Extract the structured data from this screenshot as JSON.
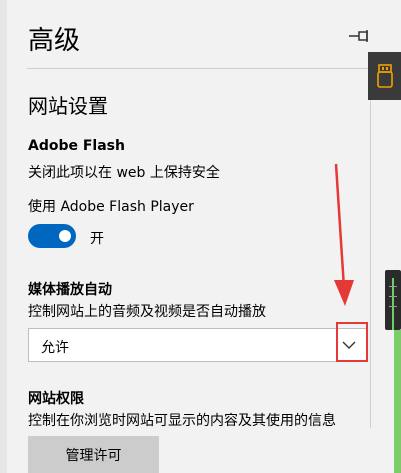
{
  "panel": {
    "title": "高级"
  },
  "website_settings": {
    "heading": "网站设置",
    "flash": {
      "title": "Adobe Flash",
      "description": "关闭此项以在 web 上保持安全",
      "toggle_label": "使用 Adobe Flash Player",
      "toggle_state": "开"
    },
    "media_autoplay": {
      "title": "媒体播放自动",
      "description": "控制网站上的音频及视频是否自动播放",
      "selected": "允许"
    },
    "permissions": {
      "title": "网站权限",
      "description": "控制在你浏览时网站可显示的内容及其使用的信息",
      "manage_button": "管理许可"
    }
  },
  "colors": {
    "toggle_on": "#0067c0",
    "highlight": "#e53935"
  },
  "icons": {
    "pin": "pin-icon",
    "chevron": "chevron-down-icon",
    "extension": "usb-extension-icon"
  }
}
